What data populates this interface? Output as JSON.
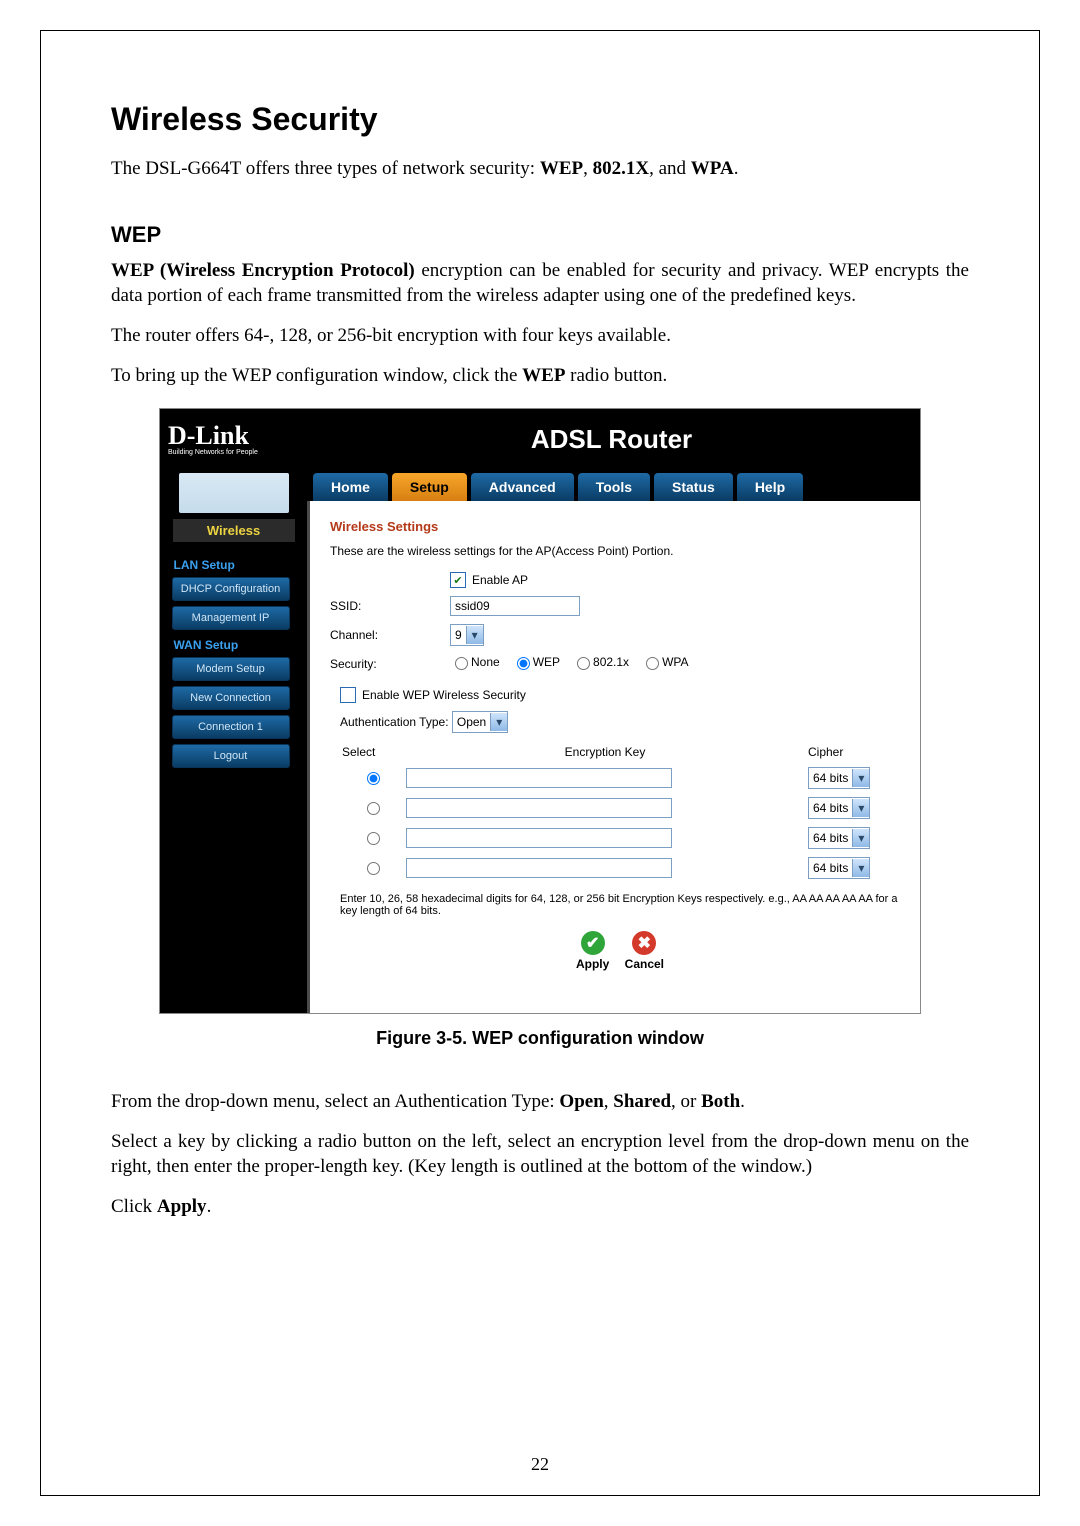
{
  "page_number": "22",
  "title": "Wireless Security",
  "intro_html": "The DSL-G664T offers three types of network security: <b>WEP</b>, <b>802.1X</b>, and <b>WPA</b>.",
  "wep_heading": "WEP",
  "wep_p1_html": "<b>WEP (Wireless Encryption Protocol)</b> encryption can be enabled for security and privacy. WEP encrypts the data portion of each frame transmitted from the wireless adapter using one of the predefined keys.",
  "wep_p2": "The router offers 64-, 128, or 256-bit encryption with four keys available.",
  "wep_p3_html": "To bring up the WEP configuration window, click the <b>WEP</b> radio button.",
  "figure_caption": "Figure 3-5. WEP configuration window",
  "after_p1_html": "From the drop-down menu, select an Authentication Type: <b>Open</b>, <b>Shared</b>, or <b>Both</b>.",
  "after_p2": "Select a key by clicking a radio button on the left, select an encryption level from the drop-down menu on the right, then enter the proper-length key. (Key length is outlined at the bottom of the window.)",
  "after_p3_html": "Click <b>Apply</b>.",
  "router": {
    "logo": "D-Link",
    "logo_tag": "Building Networks for People",
    "banner": "ADSL Router",
    "tabs": [
      "Home",
      "Setup",
      "Advanced",
      "Tools",
      "Status",
      "Help"
    ],
    "active_tab": "Setup",
    "sidebar": {
      "active": "Wireless",
      "groups": [
        {
          "heading": "LAN Setup",
          "items": [
            "DHCP Configuration",
            "Management IP"
          ]
        },
        {
          "heading": "WAN Setup",
          "items": [
            "Modem Setup",
            "New Connection",
            "Connection 1",
            "Logout"
          ]
        }
      ]
    },
    "content": {
      "section_title": "Wireless Settings",
      "section_desc": "These are the wireless settings for the AP(Access Point) Portion.",
      "enable_ap_label": "Enable AP",
      "enable_ap_checked": true,
      "ssid_label": "SSID:",
      "ssid_value": "ssid09",
      "channel_label": "Channel:",
      "channel_value": "9",
      "security_label": "Security:",
      "security_options": [
        "None",
        "WEP",
        "802.1x",
        "WPA"
      ],
      "security_selected": "WEP",
      "enable_wep_label": "Enable WEP Wireless Security",
      "enable_wep_checked": false,
      "auth_label": "Authentication Type:",
      "auth_value": "Open",
      "table": {
        "headers": [
          "Select",
          "Encryption Key",
          "Cipher"
        ],
        "rows": [
          {
            "selected": true,
            "key": "",
            "cipher": "64 bits"
          },
          {
            "selected": false,
            "key": "",
            "cipher": "64 bits"
          },
          {
            "selected": false,
            "key": "",
            "cipher": "64 bits"
          },
          {
            "selected": false,
            "key": "",
            "cipher": "64 bits"
          }
        ]
      },
      "hint": "Enter 10, 26, 58 hexadecimal digits for 64, 128, or 256 bit Encryption Keys respectively. e.g., AA AA AA AA AA for a key length of 64 bits.",
      "apply_label": "Apply",
      "cancel_label": "Cancel"
    }
  }
}
